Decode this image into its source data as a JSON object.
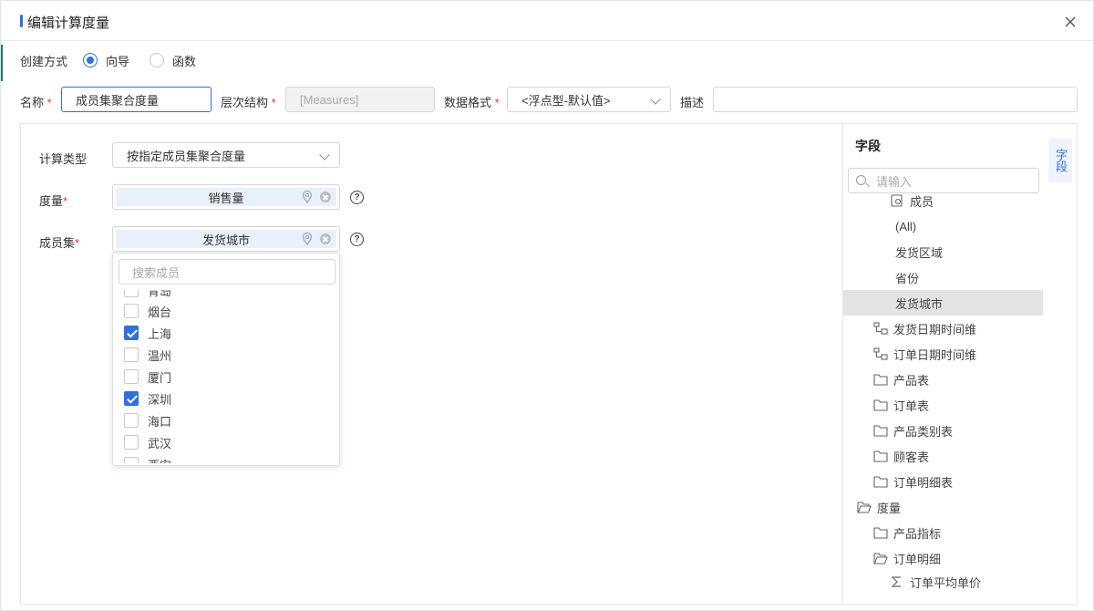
{
  "dialog": {
    "title": "编辑计算度量"
  },
  "create": {
    "label": "创建方式",
    "options": [
      {
        "label": "向导",
        "selected": true
      },
      {
        "label": "函数",
        "selected": false
      }
    ]
  },
  "form": {
    "name_label": "名称",
    "name_value": "成员集聚合度量",
    "hierarchy_label": "层次结构",
    "hierarchy_value": "[Measures]",
    "format_label": "数据格式",
    "format_value": "<浮点型-默认值>",
    "desc_label": "描述",
    "desc_value": "",
    "required_mark": "*"
  },
  "calc": {
    "type_label": "计算类型",
    "type_value": "按指定成员集聚合度量",
    "measure_label": "度量",
    "measure_value": "销售量",
    "member_label": "成员集",
    "member_value": "发货城市",
    "help_glyph": "?"
  },
  "member_dropdown": {
    "search_placeholder": "搜索成员",
    "items": [
      {
        "label": "青岛",
        "checked": false
      },
      {
        "label": "烟台",
        "checked": false
      },
      {
        "label": "上海",
        "checked": true
      },
      {
        "label": "温州",
        "checked": false
      },
      {
        "label": "厦门",
        "checked": false
      },
      {
        "label": "深圳",
        "checked": true
      },
      {
        "label": "海口",
        "checked": false
      },
      {
        "label": "武汉",
        "checked": false
      },
      {
        "label": "西安",
        "checked": false
      }
    ]
  },
  "fields": {
    "title": "字段",
    "search_placeholder": "请输入",
    "tree": [
      {
        "label": "成员",
        "icon": "member-icon",
        "indent": 2
      },
      {
        "label": "(All)",
        "icon": "",
        "indent": 3
      },
      {
        "label": "发货区域",
        "icon": "",
        "indent": 3
      },
      {
        "label": "省份",
        "icon": "",
        "indent": 3
      },
      {
        "label": "发货城市",
        "icon": "",
        "indent": 3,
        "selected": true
      },
      {
        "label": "发货日期时间维",
        "icon": "hierarchy-icon",
        "indent": 1
      },
      {
        "label": "订单日期时间维",
        "icon": "hierarchy-icon",
        "indent": 1
      },
      {
        "label": "产品表",
        "icon": "folder-icon",
        "indent": 1
      },
      {
        "label": "订单表",
        "icon": "folder-icon",
        "indent": 1
      },
      {
        "label": "产品类别表",
        "icon": "folder-icon",
        "indent": 1
      },
      {
        "label": "顾客表",
        "icon": "folder-icon",
        "indent": 1
      },
      {
        "label": "订单明细表",
        "icon": "folder-icon",
        "indent": 1
      },
      {
        "label": "度量",
        "icon": "folder-open-icon",
        "indent": 0
      },
      {
        "label": "产品指标",
        "icon": "folder-icon",
        "indent": 1
      },
      {
        "label": "订单明细",
        "icon": "folder-open-icon",
        "indent": 1
      },
      {
        "label": "订单平均单价",
        "icon": "sigma-icon",
        "indent": 2
      }
    ]
  },
  "side_tab": {
    "label": "字段"
  },
  "colors": {
    "accent": "#2f6fde",
    "tag_bg": "#e8f0fc",
    "selected_row": "#e4e4e6",
    "required": "#e33333"
  }
}
